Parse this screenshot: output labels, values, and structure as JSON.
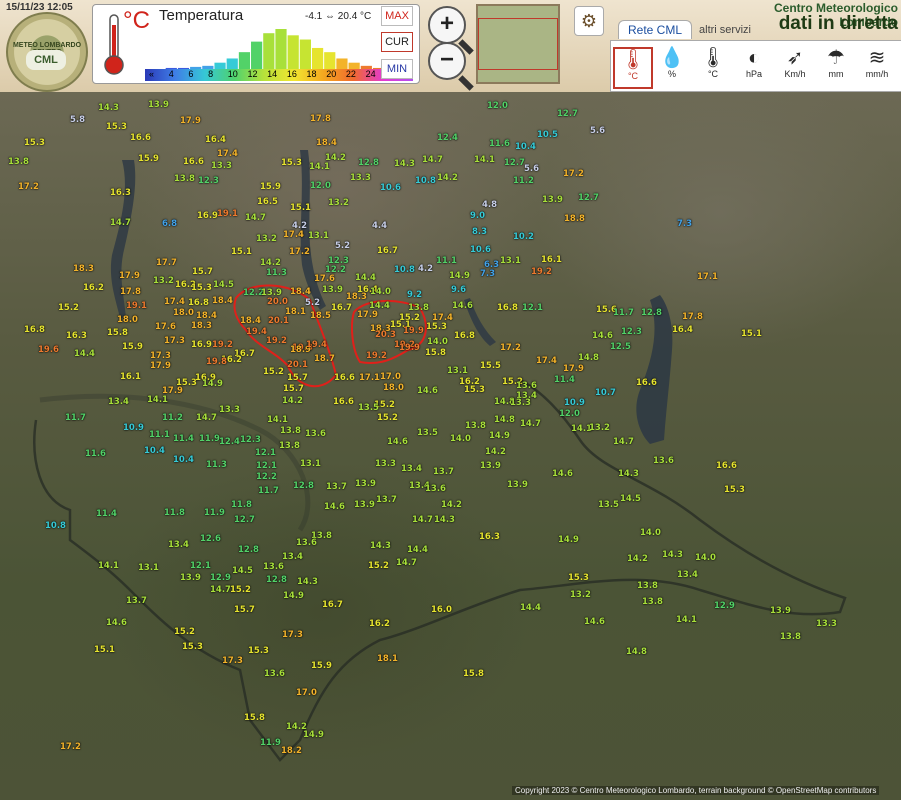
{
  "header": {
    "datetime": "15/11/23 12:05",
    "logo_text": "METEO LOMBARDO CENTRO",
    "logo_badge": "CML",
    "site_title": "Centro Meteorologico Lombardo",
    "site_subtitle": "dati in diretta"
  },
  "legend": {
    "unit": "°C",
    "title": "Temperatura",
    "range_text": "-4.1 ⇔ 20.4 °C",
    "scale_ticks": [
      "«",
      "4",
      "6",
      "8",
      "10",
      "12",
      "14",
      "16",
      "18",
      "20",
      "22",
      "24",
      "26",
      "»"
    ],
    "histogram": [
      0,
      1,
      1,
      2,
      3,
      6,
      10,
      16,
      26,
      34,
      38,
      32,
      28,
      20,
      16,
      10,
      6,
      3,
      1,
      0,
      0
    ],
    "colors": [
      "#3a5be0",
      "#42a2e8",
      "#36cbd7",
      "#52d268",
      "#a8e03a",
      "#e6e42f",
      "#f3b32a",
      "#ee7a2e",
      "#e43ad0"
    ]
  },
  "modes": {
    "max": "MAX",
    "cur": "CUR",
    "min": "MIN"
  },
  "zoom": {
    "in": "+",
    "out": "−"
  },
  "tabs": {
    "rete": "Rete CML",
    "altri": "altri servizi"
  },
  "variables": [
    {
      "sym": "🌡",
      "label": "°C"
    },
    {
      "sym": "💧",
      "label": "%"
    },
    {
      "sym": "🌡",
      "label": "°C"
    },
    {
      "sym": "◐",
      "label": "hPa"
    },
    {
      "sym": "➶",
      "label": "Km/h"
    },
    {
      "sym": "☂",
      "label": "mm"
    },
    {
      "sym": "≋",
      "label": "mm/h"
    }
  ],
  "stations": [
    [
      "5.8",
      70,
      115
    ],
    [
      "14.3",
      98,
      103
    ],
    [
      "15.3",
      106,
      122
    ],
    [
      "13.9",
      148,
      100
    ],
    [
      "17.9",
      180,
      116
    ],
    [
      "17.8",
      310,
      114
    ],
    [
      "12.0",
      487,
      101
    ],
    [
      "12.7",
      557,
      109
    ],
    [
      "5.6",
      590,
      126
    ],
    [
      "10.5",
      537,
      130
    ],
    [
      "11.6",
      489,
      139
    ],
    [
      "10.4",
      515,
      142
    ],
    [
      "15.3",
      24,
      138
    ],
    [
      "16.6",
      130,
      133
    ],
    [
      "16.4",
      205,
      135
    ],
    [
      "18.4",
      316,
      138
    ],
    [
      "12.4",
      437,
      133
    ],
    [
      "13.8",
      8,
      157
    ],
    [
      "15.9",
      138,
      154
    ],
    [
      "16.6",
      183,
      157
    ],
    [
      "17.4",
      217,
      149
    ],
    [
      "13.3",
      211,
      161
    ],
    [
      "14.2",
      325,
      153
    ],
    [
      "12.8",
      358,
      158
    ],
    [
      "14.3",
      394,
      159
    ],
    [
      "14.7",
      422,
      155
    ],
    [
      "14.1",
      474,
      155
    ],
    [
      "12.7",
      504,
      158
    ],
    [
      "5.6",
      524,
      164
    ],
    [
      "11.2",
      513,
      176
    ],
    [
      "17.2",
      563,
      169
    ],
    [
      "15.3",
      281,
      158
    ],
    [
      "14.1",
      309,
      162
    ],
    [
      "13.3",
      350,
      173
    ],
    [
      "10.8",
      415,
      176
    ],
    [
      "14.2",
      437,
      173
    ],
    [
      "17.2",
      18,
      182
    ],
    [
      "13.8",
      174,
      174
    ],
    [
      "12.3",
      198,
      176
    ],
    [
      "15.9",
      260,
      182
    ],
    [
      "12.0",
      310,
      181
    ],
    [
      "10.6",
      380,
      183
    ],
    [
      "12.7",
      578,
      193
    ],
    [
      "16.3",
      110,
      188
    ],
    [
      "16.5",
      257,
      197
    ],
    [
      "15.1",
      290,
      203
    ],
    [
      "13.2",
      328,
      198
    ],
    [
      "13.9",
      542,
      195
    ],
    [
      "4.8",
      482,
      200
    ],
    [
      "16.9",
      197,
      211
    ],
    [
      "19.1",
      217,
      209
    ],
    [
      "14.7",
      245,
      213
    ],
    [
      "9.0",
      470,
      211
    ],
    [
      "18.8",
      564,
      214
    ],
    [
      "14.7",
      110,
      218
    ],
    [
      "6.8",
      162,
      219
    ],
    [
      "4.2",
      292,
      221
    ],
    [
      "4.4",
      372,
      221
    ],
    [
      "8.3",
      472,
      227
    ],
    [
      "7.3",
      677,
      219
    ],
    [
      "13.2",
      256,
      234
    ],
    [
      "17.4",
      283,
      230
    ],
    [
      "13.1",
      308,
      231
    ],
    [
      "5.2",
      335,
      241
    ],
    [
      "10.2",
      513,
      232
    ],
    [
      "16.7",
      377,
      246
    ],
    [
      "15.1",
      231,
      247
    ],
    [
      "14.2",
      260,
      258
    ],
    [
      "17.2",
      289,
      247
    ],
    [
      "12.3",
      328,
      256
    ],
    [
      "10.6",
      470,
      245
    ],
    [
      "13.1",
      500,
      256
    ],
    [
      "6.3",
      484,
      260
    ],
    [
      "16.1",
      541,
      255
    ],
    [
      "18.3",
      73,
      264
    ],
    [
      "17.9",
      119,
      271
    ],
    [
      "17.7",
      156,
      258
    ],
    [
      "15.7",
      192,
      267
    ],
    [
      "11.3",
      266,
      268
    ],
    [
      "17.6",
      314,
      274
    ],
    [
      "12.2",
      325,
      265
    ],
    [
      "14.4",
      355,
      273
    ],
    [
      "10.8",
      394,
      265
    ],
    [
      "4.2",
      418,
      264
    ],
    [
      "11.1",
      436,
      256
    ],
    [
      "7.3",
      480,
      269
    ],
    [
      "19.2",
      531,
      267
    ],
    [
      "17.1",
      697,
      272
    ],
    [
      "16.2",
      83,
      283
    ],
    [
      "17.8",
      120,
      287
    ],
    [
      "13.2",
      153,
      276
    ],
    [
      "16.2",
      175,
      280
    ],
    [
      "15.3",
      191,
      283
    ],
    [
      "14.5",
      213,
      280
    ],
    [
      "12.2",
      243,
      288
    ],
    [
      "13.9",
      261,
      288
    ],
    [
      "18.4",
      290,
      287
    ],
    [
      "13.9",
      322,
      285
    ],
    [
      "16.4",
      357,
      285
    ],
    [
      "14.0",
      370,
      287
    ],
    [
      "9.2",
      407,
      290
    ],
    [
      "9.6",
      451,
      285
    ],
    [
      "14.9",
      449,
      271
    ],
    [
      "15.2",
      58,
      303
    ],
    [
      "19.1",
      126,
      301
    ],
    [
      "17.4",
      164,
      297
    ],
    [
      "16.8",
      188,
      298
    ],
    [
      "18.4",
      212,
      296
    ],
    [
      "20.0",
      267,
      297
    ],
    [
      "5.2",
      305,
      298
    ],
    [
      "18.3",
      346,
      292
    ],
    [
      "14.4",
      369,
      301
    ],
    [
      "13.8",
      408,
      303
    ],
    [
      "15.2",
      399,
      313
    ],
    [
      "14.6",
      452,
      301
    ],
    [
      "16.8",
      497,
      303
    ],
    [
      "12.1",
      522,
      303
    ],
    [
      "15.6",
      596,
      305
    ],
    [
      "11.7",
      613,
      308
    ],
    [
      "12.8",
      641,
      308
    ],
    [
      "17.8",
      682,
      312
    ],
    [
      "18.0",
      117,
      315
    ],
    [
      "18.0",
      173,
      308
    ],
    [
      "18.4",
      196,
      311
    ],
    [
      "18.4",
      240,
      316
    ],
    [
      "18.1",
      285,
      307
    ],
    [
      "16.7",
      331,
      303
    ],
    [
      "17.9",
      357,
      310
    ],
    [
      "17.4",
      432,
      313
    ],
    [
      "15.3",
      426,
      322
    ],
    [
      "18.5",
      310,
      311
    ],
    [
      "18.3",
      370,
      324
    ],
    [
      "15.1",
      390,
      320
    ],
    [
      "16.8",
      24,
      325
    ],
    [
      "16.3",
      66,
      331
    ],
    [
      "15.8",
      107,
      328
    ],
    [
      "17.6",
      155,
      322
    ],
    [
      "18.3",
      191,
      321
    ],
    [
      "19.4",
      246,
      327
    ],
    [
      "20.1",
      268,
      316
    ],
    [
      "20.3",
      375,
      330
    ],
    [
      "19.9",
      403,
      326
    ],
    [
      "16.8",
      454,
      331
    ],
    [
      "14.6",
      592,
      331
    ],
    [
      "12.3",
      621,
      327
    ],
    [
      "16.4",
      672,
      325
    ],
    [
      "15.1",
      741,
      329
    ],
    [
      "15.9",
      122,
      342
    ],
    [
      "17.3",
      164,
      336
    ],
    [
      "16.9",
      191,
      340
    ],
    [
      "19.2",
      212,
      340
    ],
    [
      "19.2",
      266,
      336
    ],
    [
      "19.3",
      292,
      343
    ],
    [
      "19.2",
      394,
      340
    ],
    [
      "14.0",
      427,
      337
    ],
    [
      "17.2",
      500,
      343
    ],
    [
      "12.5",
      610,
      342
    ],
    [
      "19.6",
      38,
      345
    ],
    [
      "14.4",
      74,
      349
    ],
    [
      "17.3",
      150,
      351
    ],
    [
      "16.7",
      234,
      349
    ],
    [
      "18.9",
      290,
      345
    ],
    [
      "19.4",
      306,
      340
    ],
    [
      "18.7",
      314,
      354
    ],
    [
      "19.2",
      366,
      351
    ],
    [
      "19.9",
      399,
      343
    ],
    [
      "15.8",
      425,
      348
    ],
    [
      "17.4",
      536,
      356
    ],
    [
      "14.8",
      578,
      353
    ],
    [
      "17.9",
      150,
      361
    ],
    [
      "16.2",
      221,
      355
    ],
    [
      "19.8",
      206,
      357
    ],
    [
      "17.9",
      563,
      364
    ],
    [
      "15.2",
      263,
      367
    ],
    [
      "20.1",
      287,
      360
    ],
    [
      "15.5",
      480,
      361
    ],
    [
      "15.7",
      287,
      373
    ],
    [
      "13.1",
      447,
      366
    ],
    [
      "16.1",
      120,
      372
    ],
    [
      "15.3",
      176,
      378
    ],
    [
      "16.9",
      195,
      373
    ],
    [
      "14.9",
      202,
      379
    ],
    [
      "16.6",
      334,
      373
    ],
    [
      "17.1",
      359,
      373
    ],
    [
      "17.0",
      380,
      372
    ],
    [
      "16.2",
      459,
      377
    ],
    [
      "15.2",
      502,
      377
    ],
    [
      "11.4",
      554,
      375
    ],
    [
      "10.7",
      595,
      388
    ],
    [
      "16.6",
      636,
      378
    ],
    [
      "17.9",
      162,
      386
    ],
    [
      "15.7",
      283,
      384
    ],
    [
      "18.0",
      383,
      383
    ],
    [
      "14.6",
      417,
      386
    ],
    [
      "15.3",
      464,
      385
    ],
    [
      "13.6",
      516,
      381
    ],
    [
      "13.4",
      516,
      391
    ],
    [
      "13.4",
      108,
      397
    ],
    [
      "14.1",
      147,
      395
    ],
    [
      "14.2",
      282,
      396
    ],
    [
      "16.6",
      333,
      397
    ],
    [
      "15.2",
      374,
      400
    ],
    [
      "13.5",
      358,
      403
    ],
    [
      "15.2",
      377,
      413
    ],
    [
      "14.8",
      494,
      397
    ],
    [
      "13.3",
      510,
      398
    ],
    [
      "10.9",
      564,
      398
    ],
    [
      "11.7",
      65,
      413
    ],
    [
      "11.2",
      162,
      413
    ],
    [
      "14.7",
      196,
      413
    ],
    [
      "13.3",
      219,
      405
    ],
    [
      "14.1",
      267,
      415
    ],
    [
      "12.0",
      559,
      409
    ],
    [
      "10.9",
      123,
      423
    ],
    [
      "11.1",
      149,
      430
    ],
    [
      "11.4",
      173,
      434
    ],
    [
      "11.9",
      199,
      434
    ],
    [
      "12.4",
      219,
      437
    ],
    [
      "13.8",
      280,
      426
    ],
    [
      "13.6",
      305,
      429
    ],
    [
      "14.6",
      387,
      437
    ],
    [
      "13.5",
      417,
      428
    ],
    [
      "14.0",
      450,
      434
    ],
    [
      "13.8",
      465,
      421
    ],
    [
      "14.8",
      494,
      415
    ],
    [
      "14.7",
      520,
      419
    ],
    [
      "14.1",
      571,
      424
    ],
    [
      "13.2",
      589,
      423
    ],
    [
      "14.7",
      613,
      437
    ],
    [
      "14.9",
      489,
      431
    ],
    [
      "11.6",
      85,
      449
    ],
    [
      "10.4",
      144,
      446
    ],
    [
      "10.4",
      173,
      455
    ],
    [
      "12.3",
      240,
      435
    ],
    [
      "13.8",
      279,
      441
    ],
    [
      "12.1",
      255,
      448
    ],
    [
      "14.2",
      485,
      447
    ],
    [
      "13.6",
      653,
      456
    ],
    [
      "11.3",
      206,
      460
    ],
    [
      "12.1",
      256,
      461
    ],
    [
      "13.1",
      300,
      459
    ],
    [
      "13.3",
      375,
      459
    ],
    [
      "13.4",
      401,
      464
    ],
    [
      "13.7",
      433,
      467
    ],
    [
      "13.9",
      480,
      461
    ],
    [
      "16.6",
      716,
      461
    ],
    [
      "14.3",
      618,
      469
    ],
    [
      "12.2",
      256,
      472
    ],
    [
      "13.4",
      409,
      481
    ],
    [
      "13.9",
      355,
      479
    ],
    [
      "13.7",
      326,
      482
    ],
    [
      "14.6",
      552,
      469
    ],
    [
      "11.7",
      258,
      486
    ],
    [
      "12.8",
      293,
      481
    ],
    [
      "13.6",
      425,
      484
    ],
    [
      "13.9",
      507,
      480
    ],
    [
      "13.7",
      376,
      495
    ],
    [
      "14.2",
      441,
      500
    ],
    [
      "13.5",
      598,
      500
    ],
    [
      "14.5",
      620,
      494
    ],
    [
      "15.3",
      724,
      485
    ],
    [
      "10.8",
      45,
      521
    ],
    [
      "11.4",
      96,
      509
    ],
    [
      "11.8",
      164,
      508
    ],
    [
      "11.9",
      204,
      508
    ],
    [
      "11.8",
      231,
      500
    ],
    [
      "12.7",
      234,
      515
    ],
    [
      "14.6",
      324,
      502
    ],
    [
      "13.8",
      311,
      531
    ],
    [
      "12.6",
      200,
      534
    ],
    [
      "13.9",
      354,
      500
    ],
    [
      "14.7",
      412,
      515
    ],
    [
      "14.3",
      434,
      515
    ],
    [
      "14.0",
      640,
      528
    ],
    [
      "14.9",
      558,
      535
    ],
    [
      "13.4",
      168,
      540
    ],
    [
      "12.8",
      238,
      545
    ],
    [
      "13.4",
      282,
      552
    ],
    [
      "16.3",
      479,
      532
    ],
    [
      "14.3",
      370,
      541
    ],
    [
      "14.4",
      407,
      545
    ],
    [
      "13.6",
      296,
      538
    ],
    [
      "14.3",
      662,
      550
    ],
    [
      "14.0",
      695,
      553
    ],
    [
      "14.1",
      98,
      561
    ],
    [
      "13.1",
      138,
      563
    ],
    [
      "12.1",
      190,
      561
    ],
    [
      "14.5",
      232,
      566
    ],
    [
      "13.9",
      180,
      573
    ],
    [
      "12.9",
      210,
      573
    ],
    [
      "14.7",
      210,
      585
    ],
    [
      "15.2",
      230,
      585
    ],
    [
      "14.3",
      297,
      577
    ],
    [
      "14.2",
      627,
      554
    ],
    [
      "15.2",
      368,
      561
    ],
    [
      "14.7",
      396,
      558
    ],
    [
      "13.6",
      263,
      562
    ],
    [
      "12.8",
      266,
      575
    ],
    [
      "15.3",
      568,
      573
    ],
    [
      "13.4",
      677,
      570
    ],
    [
      "13.8",
      637,
      581
    ],
    [
      "13.2",
      570,
      590
    ],
    [
      "14.9",
      283,
      591
    ],
    [
      "13.7",
      126,
      596
    ],
    [
      "13.8",
      642,
      597
    ],
    [
      "12.9",
      714,
      601
    ],
    [
      "14.4",
      520,
      603
    ],
    [
      "16.7",
      322,
      600
    ],
    [
      "16.0",
      431,
      605
    ],
    [
      "15.7",
      234,
      605
    ],
    [
      "13.9",
      770,
      606
    ],
    [
      "13.3",
      816,
      619
    ],
    [
      "14.6",
      106,
      618
    ],
    [
      "16.2",
      369,
      619
    ],
    [
      "14.6",
      584,
      617
    ],
    [
      "14.1",
      676,
      615
    ],
    [
      "15.2",
      174,
      627
    ],
    [
      "17.3",
      282,
      630
    ],
    [
      "13.8",
      780,
      632
    ],
    [
      "15.1",
      94,
      645
    ],
    [
      "15.3",
      182,
      642
    ],
    [
      "15.3",
      248,
      646
    ],
    [
      "18.1",
      377,
      654
    ],
    [
      "14.8",
      626,
      647
    ],
    [
      "17.3",
      222,
      656
    ],
    [
      "15.9",
      311,
      661
    ],
    [
      "13.6",
      264,
      669
    ],
    [
      "15.8",
      463,
      669
    ],
    [
      "17.0",
      296,
      688
    ],
    [
      "15.8",
      244,
      713
    ],
    [
      "14.2",
      286,
      722
    ],
    [
      "11.9",
      260,
      738
    ],
    [
      "18.2",
      281,
      746
    ],
    [
      "17.2",
      60,
      742
    ],
    [
      "14.9",
      303,
      730
    ]
  ],
  "copyright": "Copyright 2023 © Centro Meteorologico Lombardo, terrain background © OpenStreetMap contributors"
}
